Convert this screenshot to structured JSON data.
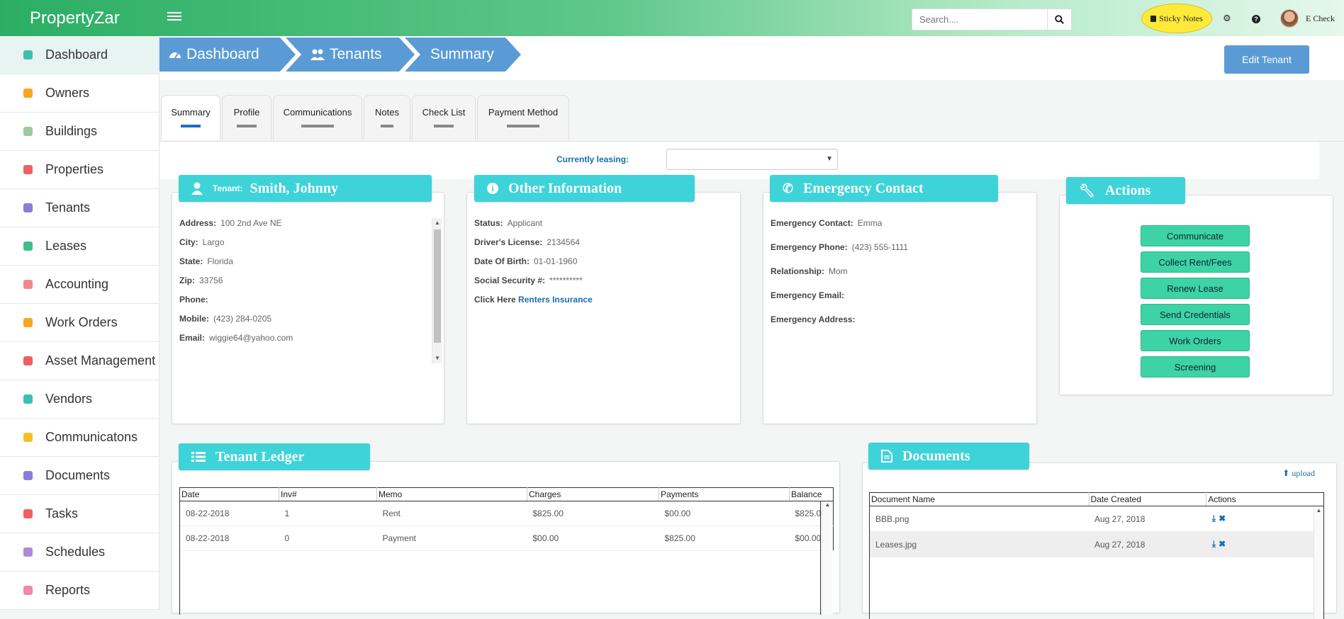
{
  "app": {
    "brand": "PropertyZar",
    "user_name": "E Check"
  },
  "search": {
    "placeholder": "Search...."
  },
  "sticky": {
    "label": "Sticky Notes"
  },
  "sidebar": {
    "items": [
      {
        "label": "Dashboard",
        "icon": "dashboard-icon",
        "color": "#3dbfb0"
      },
      {
        "label": "Owners",
        "icon": "user-icon",
        "color": "#f5a623"
      },
      {
        "label": "Buildings",
        "icon": "building-icon",
        "color": "#9fc99f"
      },
      {
        "label": "Properties",
        "icon": "home-icon",
        "color": "#f06060"
      },
      {
        "label": "Tenants",
        "icon": "users-icon",
        "color": "#8a7fd6"
      },
      {
        "label": "Leases",
        "icon": "key-icon",
        "color": "#3dbf8a"
      },
      {
        "label": "Accounting",
        "icon": "money-icon",
        "color": "#f08a8a"
      },
      {
        "label": "Work Orders",
        "icon": "wrench-icon",
        "color": "#f5a623"
      },
      {
        "label": "Asset Management",
        "icon": "list-icon",
        "color": "#f06060"
      },
      {
        "label": "Vendors",
        "icon": "person-icon",
        "color": "#3dbfb0"
      },
      {
        "label": "Communicatons",
        "icon": "tags-icon",
        "color": "#f5c023"
      },
      {
        "label": "Documents",
        "icon": "file-icon",
        "color": "#8a7fd6"
      },
      {
        "label": "Tasks",
        "icon": "tasks-icon",
        "color": "#f06060"
      },
      {
        "label": "Schedules",
        "icon": "calendar-icon",
        "color": "#b08ad6"
      },
      {
        "label": "Reports",
        "icon": "flag-icon",
        "color": "#f08aa8"
      }
    ]
  },
  "breadcrumb": {
    "items": [
      "Dashboard",
      "Tenants",
      "Summary"
    ]
  },
  "header": {
    "edit_label": "Edit Tenant"
  },
  "tabs": [
    "Summary",
    "Profile",
    "Communications",
    "Notes",
    "Check List",
    "Payment Method"
  ],
  "leasing": {
    "label": "Currently leasing:",
    "value": ""
  },
  "tenant": {
    "title_prefix": "Tenant:",
    "name": "Smith, Johnny",
    "fields": [
      {
        "label": "Address:",
        "value": "100 2nd Ave NE"
      },
      {
        "label": "City:",
        "value": "Largo"
      },
      {
        "label": "State:",
        "value": "Florida"
      },
      {
        "label": "Zip:",
        "value": "33756"
      },
      {
        "label": "Phone:",
        "value": ""
      },
      {
        "label": "Mobile:",
        "value": "(423) 284-0205"
      },
      {
        "label": "Email:",
        "value": "wiggie64@yahoo.com"
      }
    ]
  },
  "other_info": {
    "title": "Other Information",
    "fields": [
      {
        "label": "Status:",
        "value": "Applicant"
      },
      {
        "label": "Driver's License:",
        "value": "2134564"
      },
      {
        "label": "Date Of Birth:",
        "value": "01-01-1960"
      },
      {
        "label": "Social Security #:",
        "value": "**********"
      }
    ],
    "click_here": "Click Here",
    "insurance_link": "Renters Insurance"
  },
  "emergency": {
    "title": "Emergency Contact",
    "fields": [
      {
        "label": "Emergency Contact:",
        "value": "Emma"
      },
      {
        "label": "Emergency Phone:",
        "value": "(423) 555-1111"
      },
      {
        "label": "Relationship:",
        "value": "Mom"
      },
      {
        "label": "Emergency Email:",
        "value": ""
      },
      {
        "label": "Emergency Address:",
        "value": ""
      }
    ]
  },
  "actions": {
    "title": "Actions",
    "buttons": [
      "Communicate",
      "Collect Rent/Fees",
      "Renew Lease",
      "Send Credentials",
      "Work Orders",
      "Screening"
    ]
  },
  "ledger": {
    "title": "Tenant Ledger",
    "columns": [
      "Date",
      "Inv#",
      "Memo",
      "Charges",
      "Payments",
      "Balance"
    ],
    "rows": [
      [
        "08-22-2018",
        "1",
        "Rent",
        "$825.00",
        "$00.00",
        "$825.00"
      ],
      [
        "08-22-2018",
        "0",
        "Payment",
        "$00.00",
        "$825.00",
        "$00.00"
      ]
    ]
  },
  "documents": {
    "title": "Documents",
    "upload_label": "upload",
    "columns": [
      "Document Name",
      "Date Created",
      "Actions"
    ],
    "rows": [
      [
        "BBB.png",
        "Aug 27, 2018"
      ],
      [
        "Leases.jpg",
        "Aug 27, 2018"
      ]
    ]
  }
}
